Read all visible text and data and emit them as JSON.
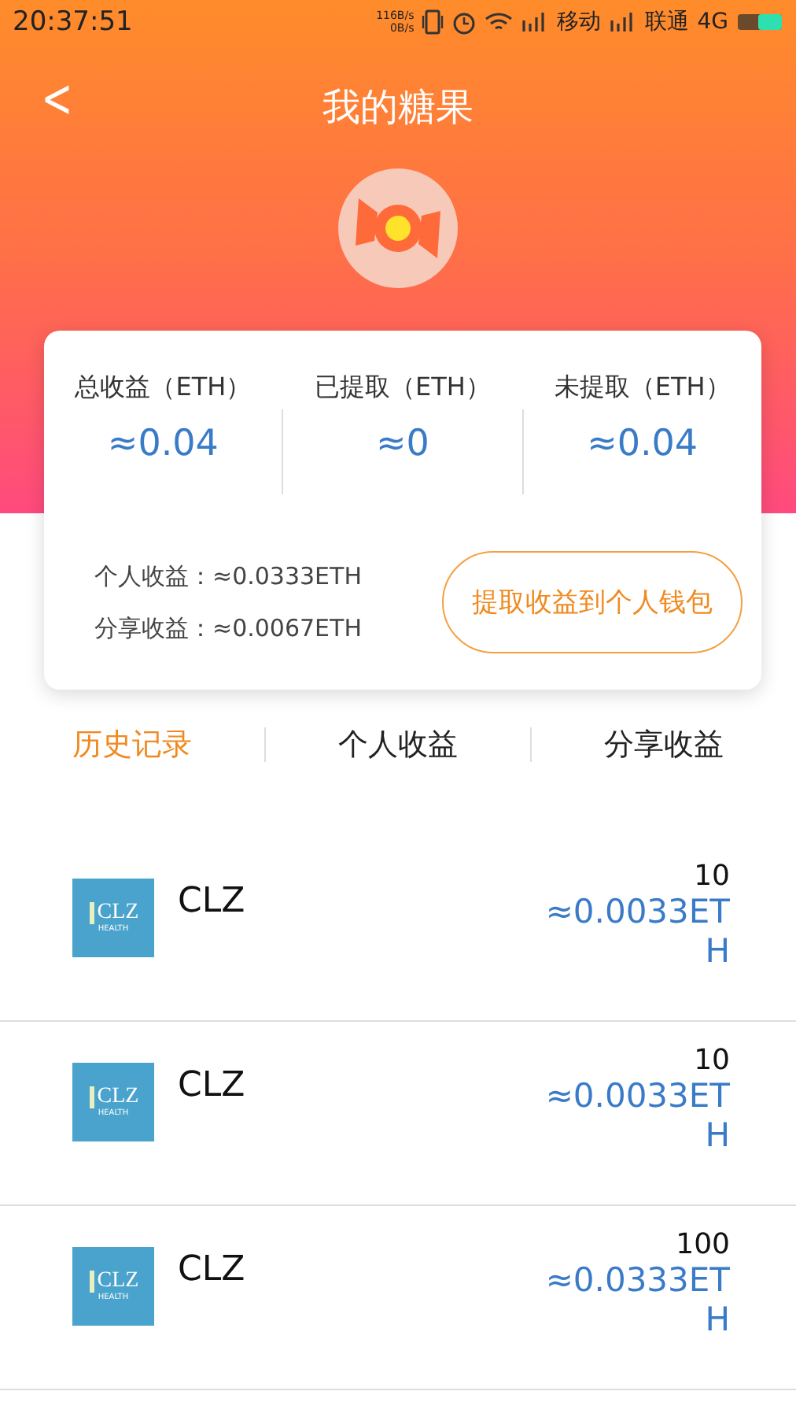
{
  "status_bar": {
    "time": "20:37:51",
    "net_up": "116B/s",
    "net_down": "0B/s",
    "carrier_1": "移动",
    "carrier_2": "联通",
    "network": "4G"
  },
  "header": {
    "back": "<",
    "title": "我的糖果"
  },
  "summary": {
    "stats": [
      {
        "label": "总收益（ETH）",
        "value": "≈0.04"
      },
      {
        "label": "已提取（ETH）",
        "value": "≈0"
      },
      {
        "label": "未提取（ETH）",
        "value": "≈0.04"
      }
    ],
    "details": [
      "个人收益：≈0.0333ETH",
      "分享收益：≈0.0067ETH"
    ],
    "withdraw_button": "提取收益到个人钱包"
  },
  "tabs": [
    {
      "label": "历史记录",
      "selected": true
    },
    {
      "label": "个人收益",
      "selected": false
    },
    {
      "label": "分享收益",
      "selected": false
    }
  ],
  "records": [
    {
      "logo_text": "CLZ",
      "logo_subtext": "HEALTH",
      "name": "CLZ",
      "count": "10",
      "amount": "≈0.0033ETH"
    },
    {
      "logo_text": "CLZ",
      "logo_subtext": "HEALTH",
      "name": "CLZ",
      "count": "10",
      "amount": "≈0.0033ETH"
    },
    {
      "logo_text": "CLZ",
      "logo_subtext": "HEALTH",
      "name": "CLZ",
      "count": "100",
      "amount": "≈0.0333ETH"
    }
  ]
}
